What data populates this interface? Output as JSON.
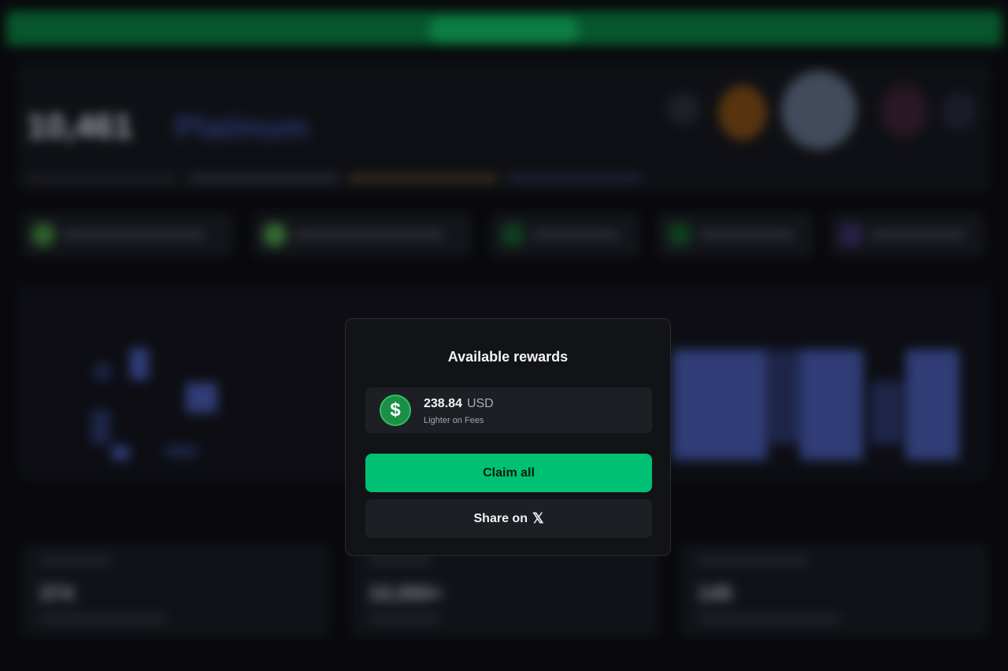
{
  "modal": {
    "title": "Available rewards",
    "reward": {
      "icon": "dollar-coin-icon",
      "symbol": "$",
      "amount": "238.84",
      "currency": "USD",
      "source": "Lighter on Fees"
    },
    "claim_label": "Claim all",
    "share_label": "Share on",
    "share_icon": "𝕏"
  },
  "background": {
    "points": "10,461",
    "tier": "Platinum",
    "cards": [
      "374",
      "10,000+",
      "145"
    ]
  },
  "colors": {
    "accent": "#00c074",
    "modal_bg": "#121317",
    "row_bg": "#1d1f25"
  }
}
